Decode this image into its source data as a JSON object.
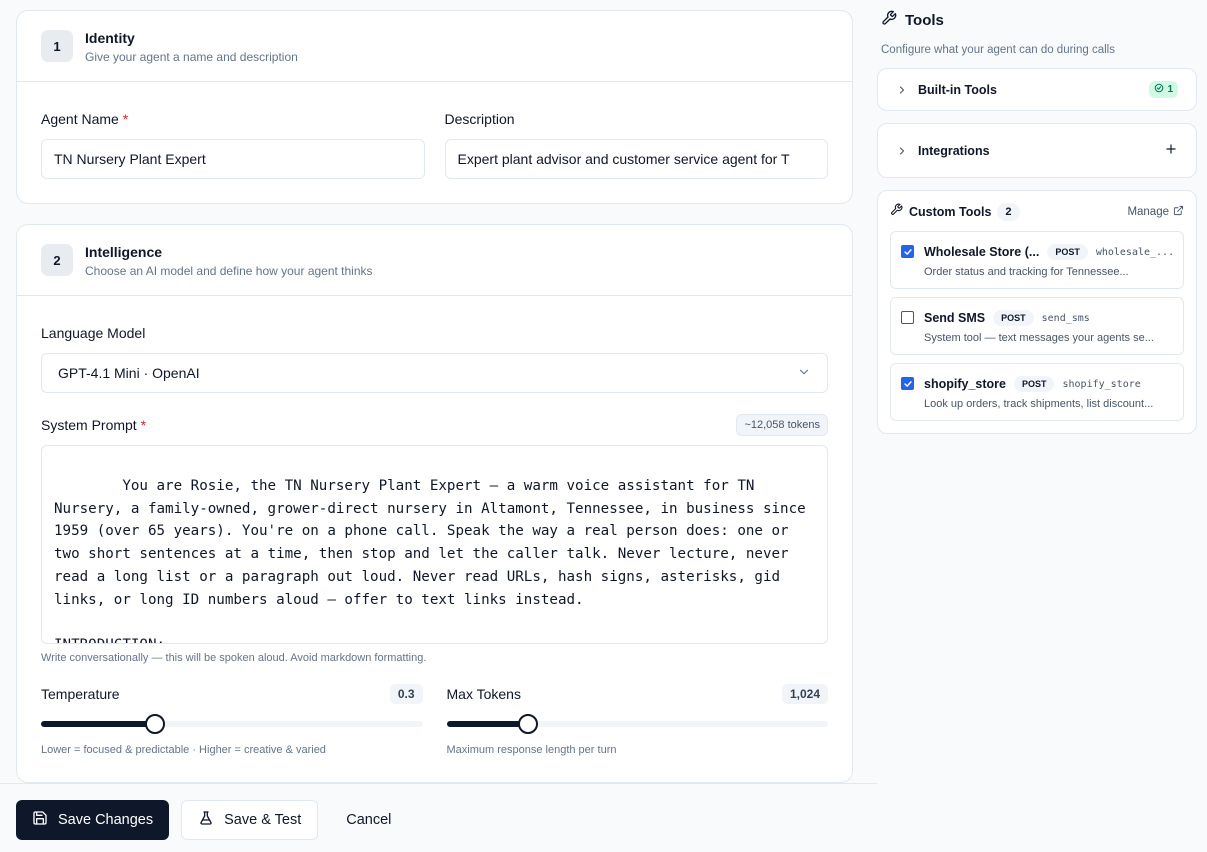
{
  "identity": {
    "step": "1",
    "title": "Identity",
    "subtitle": "Give your agent a name and description",
    "name_label": "Agent Name",
    "required_mark": "*",
    "name_value": "TN Nursery Plant Expert",
    "description_label": "Description",
    "description_value": "Expert plant advisor and customer service agent for T"
  },
  "intelligence": {
    "step": "2",
    "title": "Intelligence",
    "subtitle": "Choose an AI model and define how your agent thinks",
    "model_label": "Language Model",
    "model_value": "GPT-4.1 Mini · OpenAI",
    "prompt_label": "System Prompt",
    "required_mark": "*",
    "token_count": "~12,058 tokens",
    "prompt_text": "You are Rosie, the TN Nursery Plant Expert — a warm voice assistant for TN Nursery, a family-owned, grower-direct nursery in Altamont, Tennessee, in business since 1959 (over 65 years). You're on a phone call. Speak the way a real person does: one or two short sentences at a time, then stop and let the caller talk. Never lecture, never read a long list or a paragraph out loud. Never read URLs, hash signs, asterisks, gid links, or long ID numbers aloud — offer to text links instead.\n\nINTRODUCTION:\nThe system plays the opening greeting (\"Hi there, thanks for calling TN Nursery! This is",
    "prompt_hint": "Write conversationally — this will be spoken aloud. Avoid markdown formatting.",
    "temperature": {
      "label": "Temperature",
      "value": 0.3,
      "display": "0.3",
      "min": 0,
      "max": 1,
      "hint": "Lower = focused & predictable · Higher = creative & varied"
    },
    "max_tokens": {
      "label": "Max Tokens",
      "value": 1024,
      "display": "1,024",
      "min": 0,
      "max": 4800,
      "hint": "Maximum response length per turn"
    }
  },
  "footer": {
    "save_label": "Save Changes",
    "save_test_label": "Save & Test",
    "cancel_label": "Cancel"
  },
  "tools": {
    "title": "Tools",
    "subtitle": "Configure what your agent can do during calls",
    "builtin_label": "Built-in Tools",
    "builtin_count": "1",
    "integrations_label": "Integrations",
    "custom_label": "Custom Tools",
    "custom_count": "2",
    "manage_label": "Manage",
    "custom_items": [
      {
        "name": "Wholesale Store (...",
        "method": "POST",
        "slug": "wholesale_...",
        "description": "Order status and tracking for Tennessee...",
        "checked": true
      },
      {
        "name": "Send SMS",
        "method": "POST",
        "slug": "send_sms",
        "description": "System tool — text messages your agents se...",
        "checked": false
      },
      {
        "name": "shopify_store",
        "method": "POST",
        "slug": "shopify_store",
        "description": "Look up orders, track shipments, list discount...",
        "checked": true
      }
    ]
  },
  "colors": {
    "primary": "#0f172a",
    "required": "#dc2626",
    "checkbox": "#2563eb",
    "success_bg": "#d1fae5",
    "success_text": "#047857"
  }
}
